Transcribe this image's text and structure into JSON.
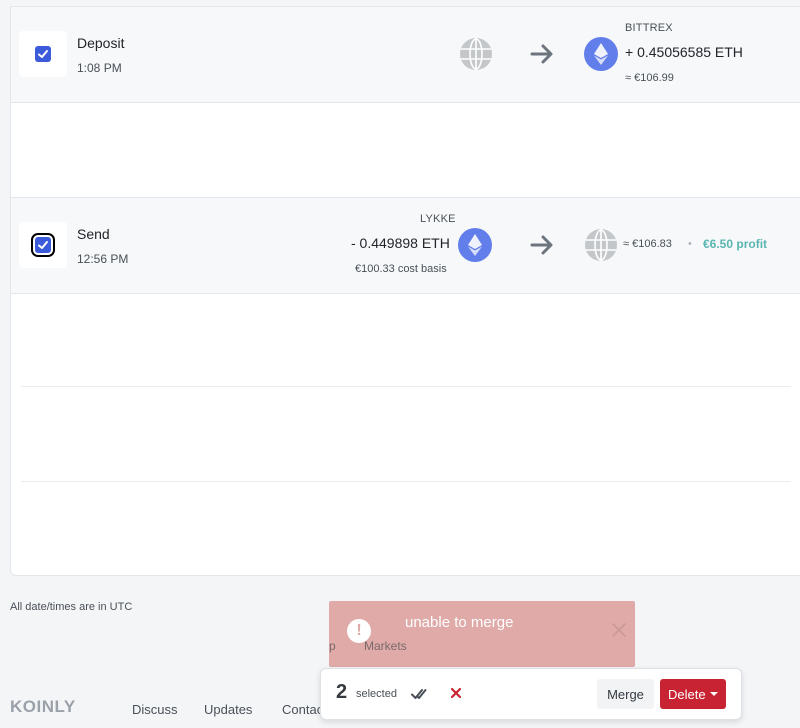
{
  "transactions": [
    {
      "type": "Deposit",
      "time": "1:08 PM",
      "to": {
        "exchange": "BITTREX",
        "amount": "+ 0.45056585 ETH",
        "value": "≈ €106.99"
      }
    },
    {
      "type": "Send",
      "time": "12:56 PM",
      "from": {
        "exchange": "LYKKE",
        "amount": "- 0.449898 ETH",
        "cost_basis": "€100.33 cost basis"
      },
      "to": {
        "value": "≈ €106.83",
        "separator": "•",
        "profit": "€6.50 profit"
      }
    }
  ],
  "footnote": "All date/times are in UTC",
  "footer": {
    "logo": "KOINLY",
    "links": [
      "Discuss",
      "Updates",
      "Contac"
    ],
    "hidden_links": [
      "p",
      "Markets"
    ]
  },
  "toast": {
    "icon": "!",
    "message": "unable to merge"
  },
  "selection": {
    "count": "2",
    "label": "selected",
    "merge_label": "Merge",
    "delete_label": "Delete"
  },
  "colors": {
    "accent": "#3b5bdb",
    "eth": "#627eea",
    "profit": "#59b5b0",
    "danger": "#c82333",
    "toast": "#dfaaa8"
  }
}
